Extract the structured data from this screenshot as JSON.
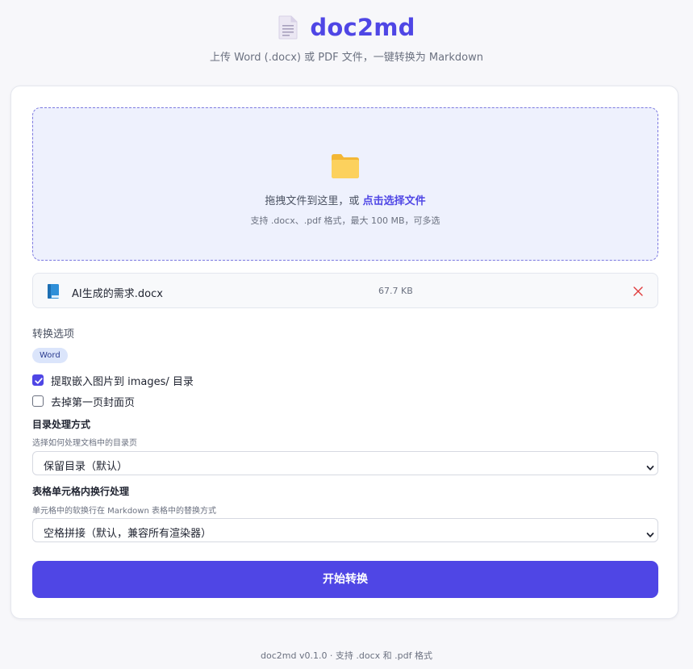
{
  "header": {
    "title": "doc2md",
    "subtitle": "上传 Word (.docx) 或 PDF 文件，一键转换为 Markdown",
    "icon": "document-icon"
  },
  "dropzone": {
    "icon": "folder-icon",
    "text_before": "拖拽文件到这里，或 ",
    "link_text": "点击选择文件",
    "hint": "支持 .docx、.pdf 格式，最大 100 MB，可多选"
  },
  "file": {
    "icon": "book-icon",
    "name": "AI生成的需求.docx",
    "size": "67.7 KB",
    "remove_icon": "close-icon"
  },
  "options": {
    "title": "转换选项",
    "badge": "Word",
    "extract_images": {
      "label": "提取嵌入图片到 images/ 目录",
      "checked": true
    },
    "remove_cover": {
      "label": "去掉第一页封面页",
      "checked": false
    },
    "toc": {
      "label": "目录处理方式",
      "hint": "选择如何处理文档中的目录页",
      "selected": "保留目录（默认）"
    },
    "table_breaks": {
      "label": "表格单元格内换行处理",
      "hint": "单元格中的软换行在 Markdown 表格中的替换方式",
      "selected": "空格拼接（默认，兼容所有渲染器）"
    }
  },
  "action": {
    "convert_label": "开始转换"
  },
  "footer": {
    "text": "doc2md v0.1.0 · 支持 .docx 和 .pdf 格式"
  },
  "colors": {
    "accent": "#4f46e5",
    "dropzone_bg": "#eef1fd",
    "remove": "#e03b3b"
  }
}
